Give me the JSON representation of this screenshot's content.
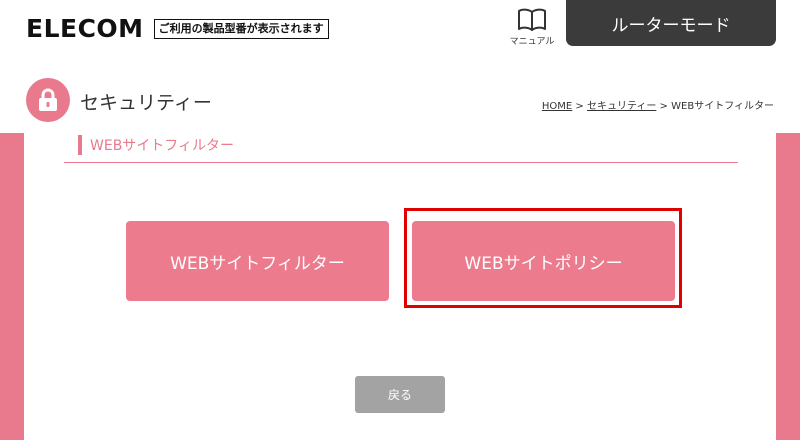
{
  "brand": {
    "logo_text": "ELECOM",
    "model_prompt": "ご利用の製品型番が表示されます"
  },
  "header": {
    "manual_label": "マニュアル",
    "mode_button": "ルーターモード"
  },
  "page": {
    "title": "セキュリティー",
    "section_title": "WEBサイトフィルター"
  },
  "breadcrumb": {
    "home": "HOME",
    "sep1": " > ",
    "security": "セキュリティー",
    "sep2": " > ",
    "current": "WEBサイトフィルター"
  },
  "tiles": [
    {
      "label": "WEBサイトフィルター"
    },
    {
      "label": "WEBサイトポリシー"
    }
  ],
  "back_button": "戻る",
  "icons": {
    "manual": "book-icon",
    "security": "lock-icon"
  },
  "colors": {
    "accent": "#e9798c",
    "tile": "#ec7b8e",
    "header_dark": "#3b3b3b",
    "highlight": "#e00000",
    "back": "#a3a3a3"
  }
}
